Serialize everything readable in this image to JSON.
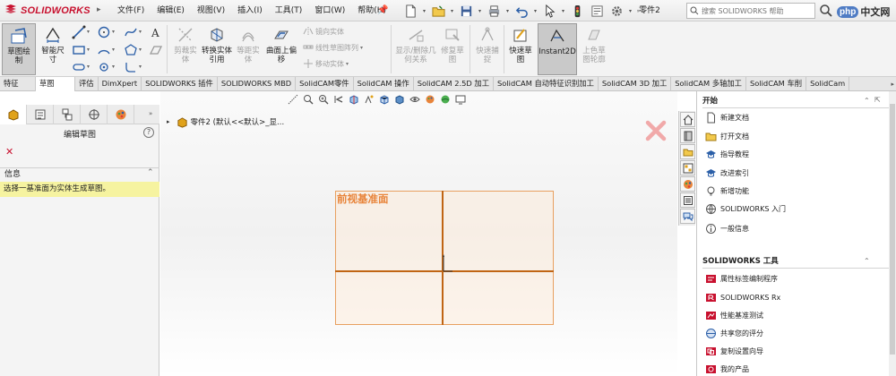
{
  "app": {
    "logo_text": "SOLIDWORKS",
    "document_name": "零件2",
    "brand_color": "#c8102e"
  },
  "menu": {
    "items": [
      "文件(F)",
      "编辑(E)",
      "视图(V)",
      "插入(I)",
      "工具(T)",
      "窗口(W)",
      "帮助(H)"
    ]
  },
  "search": {
    "placeholder": "搜索 SOLIDWORKS 帮助"
  },
  "watermark": {
    "badge": "php",
    "text": "中文网"
  },
  "ribbon": {
    "sketch": "草图绘制",
    "smart_dimension": "智能尺寸",
    "mirror_entities": "剪裁实体",
    "convert_entities": "转换实体引用",
    "offset_entities": "等距实体",
    "offset_on_surface": "曲面上偏移",
    "mirror": "镜向实体",
    "linear_pattern": "线性草图阵列",
    "move_entities": "移动实体",
    "display_relations": "显示/删除几何关系",
    "repair_sketch": "修复草图",
    "quick_snaps": "快速捕捉",
    "rapid_sketch": "快速草图",
    "instant2d": "Instant2D",
    "shaded_sketch": "上色草图轮廓"
  },
  "ribbon_groups": {
    "features_tab": "特征",
    "sketch_tab": "草图"
  },
  "cm_tabs": [
    "评估",
    "DimXpert",
    "SOLIDWORKS 插件",
    "SOLIDWORKS MBD",
    "SolidCAM零件",
    "SolidCAM 操作",
    "SolidCAM 2.5D 加工",
    "SolidCAM 自动特征识别加工",
    "SolidCAM 3D 加工",
    "SolidCAM 多轴加工",
    "SolidCAM 车削",
    "SolidCam"
  ],
  "property_manager": {
    "title": "编辑草图",
    "info_heading": "信息",
    "info_message": "选择一基准面为实体生成草图。"
  },
  "tree": {
    "root_label": "零件2 (默认<<默认>_显..."
  },
  "graphics": {
    "plane_label": "前视基准面",
    "plane_color": "#e8843a",
    "axis_color": "#c06514"
  },
  "task_pane": {
    "section_start": "开始",
    "start_links": [
      "新建文档",
      "打开文档",
      "指导教程",
      "改进索引",
      "新增功能",
      "SOLIDWORKS 入门",
      "一般信息"
    ],
    "section_tools": "SOLIDWORKS 工具",
    "tools_links": [
      "属性标签编制程序",
      "SOLIDWORKS Rx",
      "性能基准测试",
      "共享您的评分",
      "复制设置向导",
      "我的产品"
    ]
  }
}
